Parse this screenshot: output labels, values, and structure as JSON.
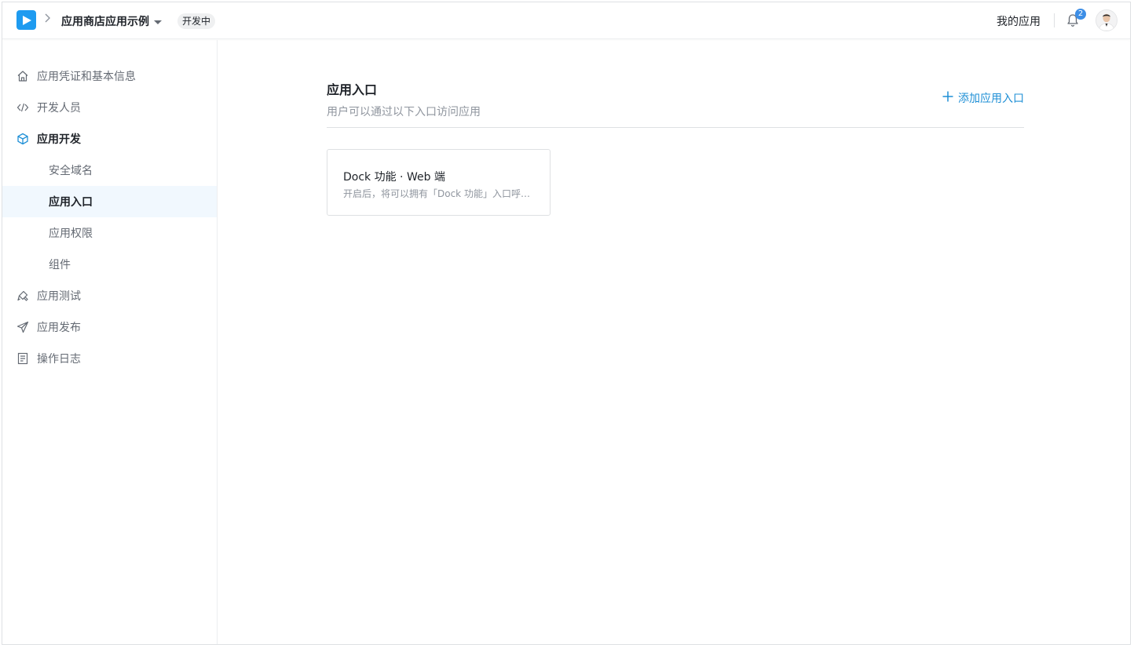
{
  "header": {
    "app_name": "应用商店应用示例",
    "status_badge": "开发中",
    "my_apps_link": "我的应用",
    "notification_count": "2"
  },
  "sidebar": {
    "items": [
      {
        "label": "应用凭证和基本信息",
        "icon": "home-icon"
      },
      {
        "label": "开发人员",
        "icon": "code-icon"
      },
      {
        "label": "应用开发",
        "icon": "cube-icon"
      },
      {
        "label": "安全域名"
      },
      {
        "label": "应用入口"
      },
      {
        "label": "应用权限"
      },
      {
        "label": "组件"
      },
      {
        "label": "应用测试",
        "icon": "brush-icon"
      },
      {
        "label": "应用发布",
        "icon": "send-icon"
      },
      {
        "label": "操作日志",
        "icon": "log-icon"
      }
    ]
  },
  "main": {
    "title": "应用入口",
    "description": "用户可以通过以下入口访问应用",
    "add_button_label": "添加应用入口",
    "cards": [
      {
        "title": "Dock 功能 · Web 端",
        "description": "开启后，将可以拥有「Dock 功能」入口呼出应用"
      }
    ]
  },
  "colors": {
    "accent": "#1e8fd6",
    "logo": "#1e9bf0",
    "selected_bg": "#f1f8fe",
    "badge": "#3d8ee6"
  }
}
